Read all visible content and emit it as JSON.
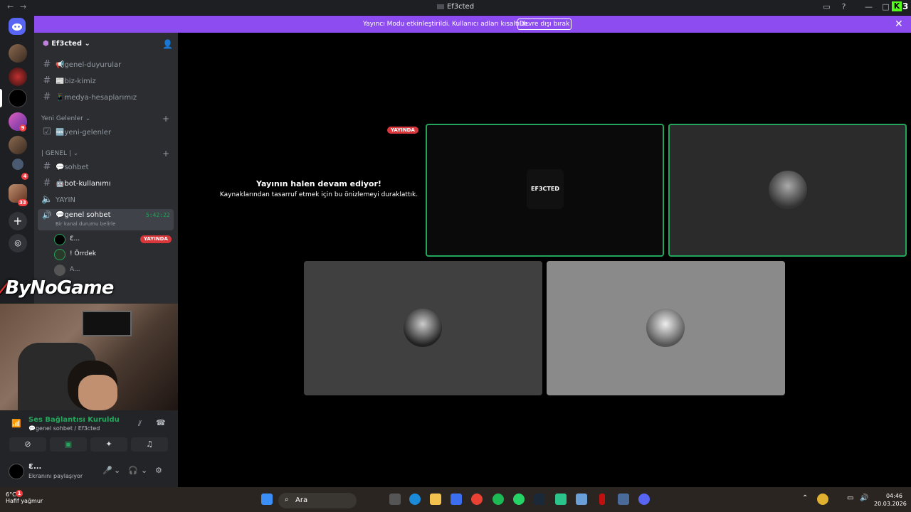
{
  "window": {
    "title": "Ef3cted"
  },
  "banner": {
    "message": "Yayıncı Modu etkinleştirildi. Kullanıcı adları kısaltıldı.",
    "disable_label": "Devre dışı bırak"
  },
  "server": {
    "name": "Ef3cted",
    "channels_top": [
      {
        "label": "📢genel-duyurular"
      },
      {
        "label": "📰biz-kimiz"
      },
      {
        "label": "📱medya-hesaplarımız"
      }
    ],
    "cat_new": "Yeni Gelenler",
    "channel_new": "🆕yeni-gelenler",
    "cat_general": "| GENEL |",
    "channels_general": [
      {
        "label": "💬sohbet"
      },
      {
        "label": "🤖bot-kullanımı"
      },
      {
        "label": "YAYIN"
      }
    ],
    "voice_channel": "💬genel sohbet",
    "voice_timer": "5:42:22",
    "voice_status": "Bir kanal durumu belirle",
    "voice_users": [
      {
        "name": "Ɛ...",
        "live": "YAYINDA"
      },
      {
        "name": "! Örrdek"
      },
      {
        "name": "A..."
      }
    ]
  },
  "overlay": {
    "logo": "ByNoGame"
  },
  "voice_panel": {
    "status": "Ses Bağlantısı Kuruldu",
    "channel": "💬genel sohbet / Ef3cted"
  },
  "user": {
    "name": "Ɛ...",
    "status": "Ekranını paylaşıyor"
  },
  "stage": {
    "live_tag": "YAYINDA",
    "paused_title": "Yayının halen devam ediyor!",
    "paused_sub": "Kaynaklarından tasarruf etmek için bu önizlemeyi duraklattık.",
    "tile1_logo": "EF3CTED"
  },
  "rail_badges": [
    "9",
    "4",
    "33"
  ],
  "taskbar": {
    "temp": "6°C",
    "weather": "Hafif yağmur",
    "search": "Ara",
    "time": "04:46",
    "date": "20.03.2026",
    "notif": "1"
  },
  "colors": {
    "accent": "#5865f2",
    "banner": "#8d4cf0",
    "live": "#da373c",
    "green": "#23a55a"
  }
}
